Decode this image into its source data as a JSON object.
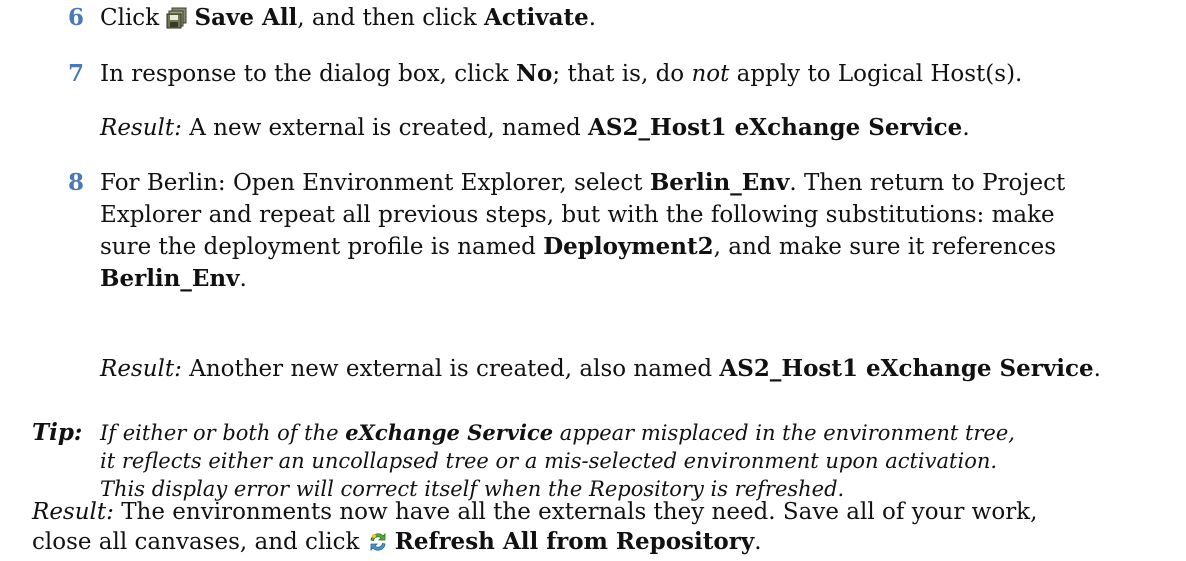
{
  "steps": [
    {
      "num": "6",
      "t1": "Click",
      "icon": "save-all-icon",
      "b1": "Save All",
      "t2": ", and then click",
      "b2": "Activate",
      "t3": "."
    },
    {
      "num": "7",
      "t1": "In response to the dialog box, click",
      "b1": "No",
      "t2": "; that is, do",
      "i1": "not",
      "t3": "apply to Logical Host(s).",
      "result_label": "Result:",
      "result_text": "A new external is created, named",
      "result_bold": "AS2_Host1 eXchange Service",
      "result_end": "."
    },
    {
      "num": "8",
      "l1_t1": "For Berlin: Open Environment Explorer, select",
      "l1_b1": "Berlin_Env",
      "l1_t2": ". Then return to Project",
      "l2": "Explorer and repeat all previous steps, but with the following substitutions: make",
      "l3_t1": "sure the deployment profile is named",
      "l3_b1": "Deployment2",
      "l3_t2": ", and make sure it references",
      "l4_b1": "Berlin_Env",
      "l4_t1": ".",
      "result_label": "Result:",
      "result_text": "Another new external is created, also named",
      "result_bold": "AS2_Host1 eXchange Service",
      "result_end": "."
    }
  ],
  "tip": {
    "label": "Tip:",
    "l1_t1": "If either or both of the",
    "l1_b1": "eXchange Service",
    "l1_t2": "appear misplaced in the environment tree,",
    "l2": "it reflects either an uncollapsed tree or a mis-selected environment upon activation.",
    "l3": "This display error will correct itself when the Repository is refreshed."
  },
  "final": {
    "label": "Result:",
    "l1": "The environments now have all the externals they need. Save all of your work,",
    "l2_t1": "close all canvases, and click",
    "icon": "refresh-icon",
    "l2_b1": "Refresh All from Repository",
    "l2_t2": "."
  },
  "colors": {
    "step_number": "#4a78b8",
    "text": "#111111"
  }
}
